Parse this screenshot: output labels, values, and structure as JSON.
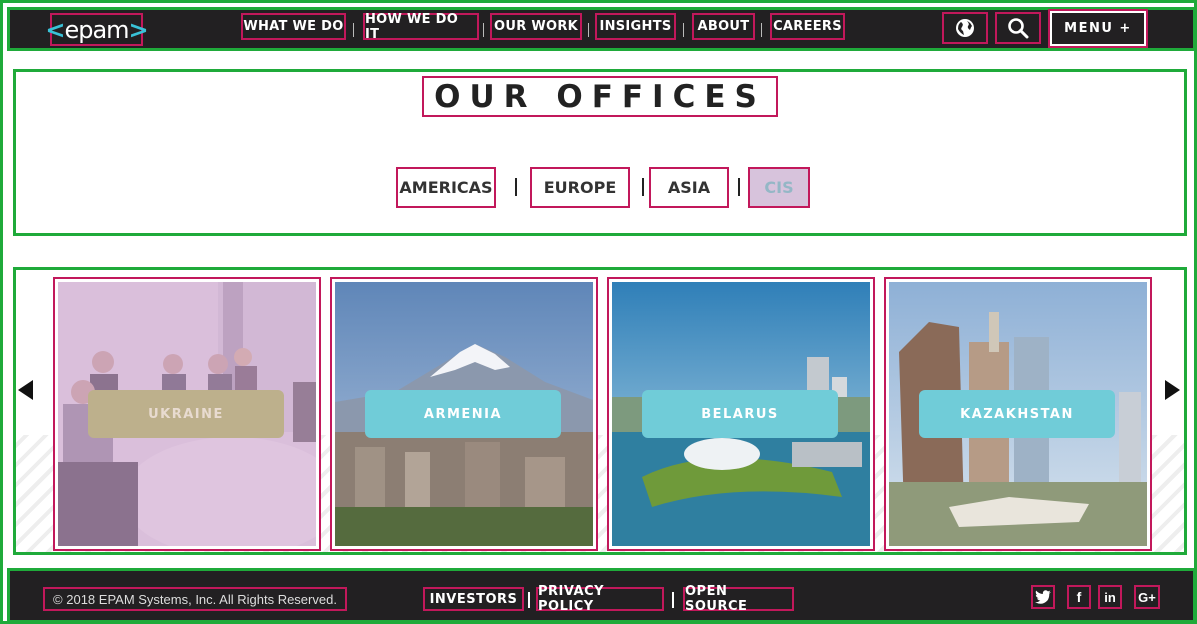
{
  "header": {
    "logo_text": "epam",
    "nav": [
      "WHAT WE DO",
      "HOW WE DO IT",
      "OUR WORK",
      "INSIGHTS",
      "ABOUT",
      "CAREERS"
    ],
    "globe_icon": "globe-icon",
    "search_icon": "search-icon",
    "menu_label": "MENU +"
  },
  "offices": {
    "title": "OUR OFFICES",
    "tabs": [
      "AMERICAS",
      "EUROPE",
      "ASIA",
      "CIS"
    ],
    "active_tab": "CIS"
  },
  "carousel": {
    "cards": [
      {
        "label": "UKRAINE"
      },
      {
        "label": "ARMENIA"
      },
      {
        "label": "BELARUS"
      },
      {
        "label": "KAZAKHSTAN"
      }
    ],
    "prev_icon": "arrow-left-icon",
    "next_icon": "arrow-right-icon"
  },
  "footer": {
    "copyright": "© 2018 EPAM Systems, Inc. All Rights Reserved.",
    "links": [
      "INVESTORS",
      "PRIVACY POLICY",
      "OPEN SOURCE"
    ],
    "social": [
      "twitter-icon",
      "facebook-icon",
      "linkedin-icon",
      "google-plus-icon"
    ]
  },
  "colors": {
    "header_bg": "#222022",
    "accent": "#39c2d7",
    "card_label": "#70ccd8",
    "highlight_border": "#c2185b",
    "region_border": "#1faa3a"
  }
}
